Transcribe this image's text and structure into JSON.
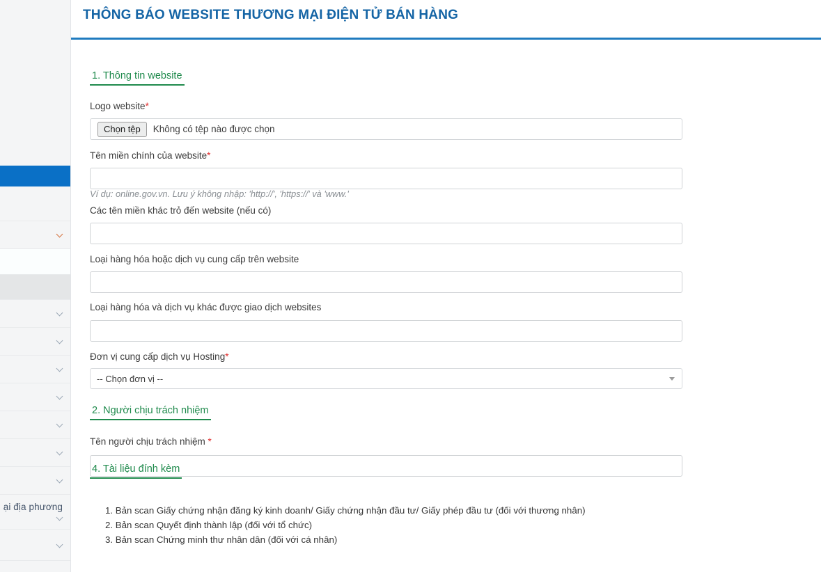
{
  "header": {
    "title": "THÔNG BÁO WEBSITE THƯƠNG MẠI ĐIỆN TỬ BÁN HÀNG",
    "accent_color": "#1f7bbf",
    "title_color": "#1464a5"
  },
  "theme": {
    "section_green": "#1f8a4c",
    "required_red": "#e02b2b",
    "sidebar_active_blue": "#0a70c6"
  },
  "sidebar": {
    "items": [
      {
        "label": "",
        "icon": "",
        "state": "plain"
      },
      {
        "label": "",
        "icon": "",
        "state": "active"
      },
      {
        "label": "",
        "icon": "",
        "state": "plain"
      },
      {
        "label": "",
        "icon": "chevron-down-icon",
        "state": "plain-orange"
      },
      {
        "label": "",
        "icon": "",
        "state": "pale"
      },
      {
        "label": "",
        "icon": "",
        "state": "grey"
      },
      {
        "label": "",
        "icon": "chevron-down-icon",
        "state": "plain"
      },
      {
        "label": "",
        "icon": "chevron-down-icon",
        "state": "plain"
      },
      {
        "label": "",
        "icon": "chevron-down-icon",
        "state": "plain"
      },
      {
        "label": "",
        "icon": "chevron-down-icon",
        "state": "plain"
      },
      {
        "label": "",
        "icon": "chevron-down-icon",
        "state": "plain"
      },
      {
        "label": "",
        "icon": "chevron-down-icon",
        "state": "plain"
      },
      {
        "label": "ại địa phương",
        "icon": "chevron-down-icon",
        "state": "plain"
      },
      {
        "label": "",
        "icon": "chevron-down-icon",
        "state": "plain"
      }
    ]
  },
  "sections": {
    "website_info": {
      "heading": "1. Thông tin website",
      "logo_label": "Logo website",
      "logo_required": "*",
      "file_button": "Chọn tệp",
      "file_status": "Không có tệp nào được chọn",
      "domain_label": "Tên miền chính của website",
      "domain_required": "*",
      "domain_value": "",
      "domain_placeholder": "",
      "domain_hint": "Ví dụ: online.gov.vn. Lưu ý không nhập: 'http://', 'https://' và 'www.'",
      "other_domains_label": "Các tên miền khác trỏ đến website (nếu có)",
      "other_domains_value": "",
      "goods_label": "Loại hàng hóa hoặc dịch vụ cung cấp trên website",
      "goods_value": "",
      "other_goods_label": "Loại hàng hóa và dịch vụ khác được giao dịch websites",
      "other_goods_value": "",
      "hosting_label": "Đơn vị cung cấp dịch vụ Hosting",
      "hosting_required": "*",
      "hosting_selected": "-- Chọn đơn vị --"
    },
    "responsible_person": {
      "heading": "2. Người chịu trách nhiệm",
      "name_label": "Tên người chịu trách nhiệm",
      "name_required": "*",
      "name_value": ""
    },
    "attachments": {
      "heading": "4. Tài liệu đính kèm",
      "documents": [
        "1. Bản scan Giấy chứng nhận đăng ký kinh doanh/ Giấy chứng nhận đầu tư/ Giấy phép đầu tư (đối với thương nhân)",
        "2. Bản scan Quyết định thành lập (đối với tổ chức)",
        "3. Bản scan Chứng minh thư nhân dân (đối với cá nhân)"
      ]
    }
  }
}
